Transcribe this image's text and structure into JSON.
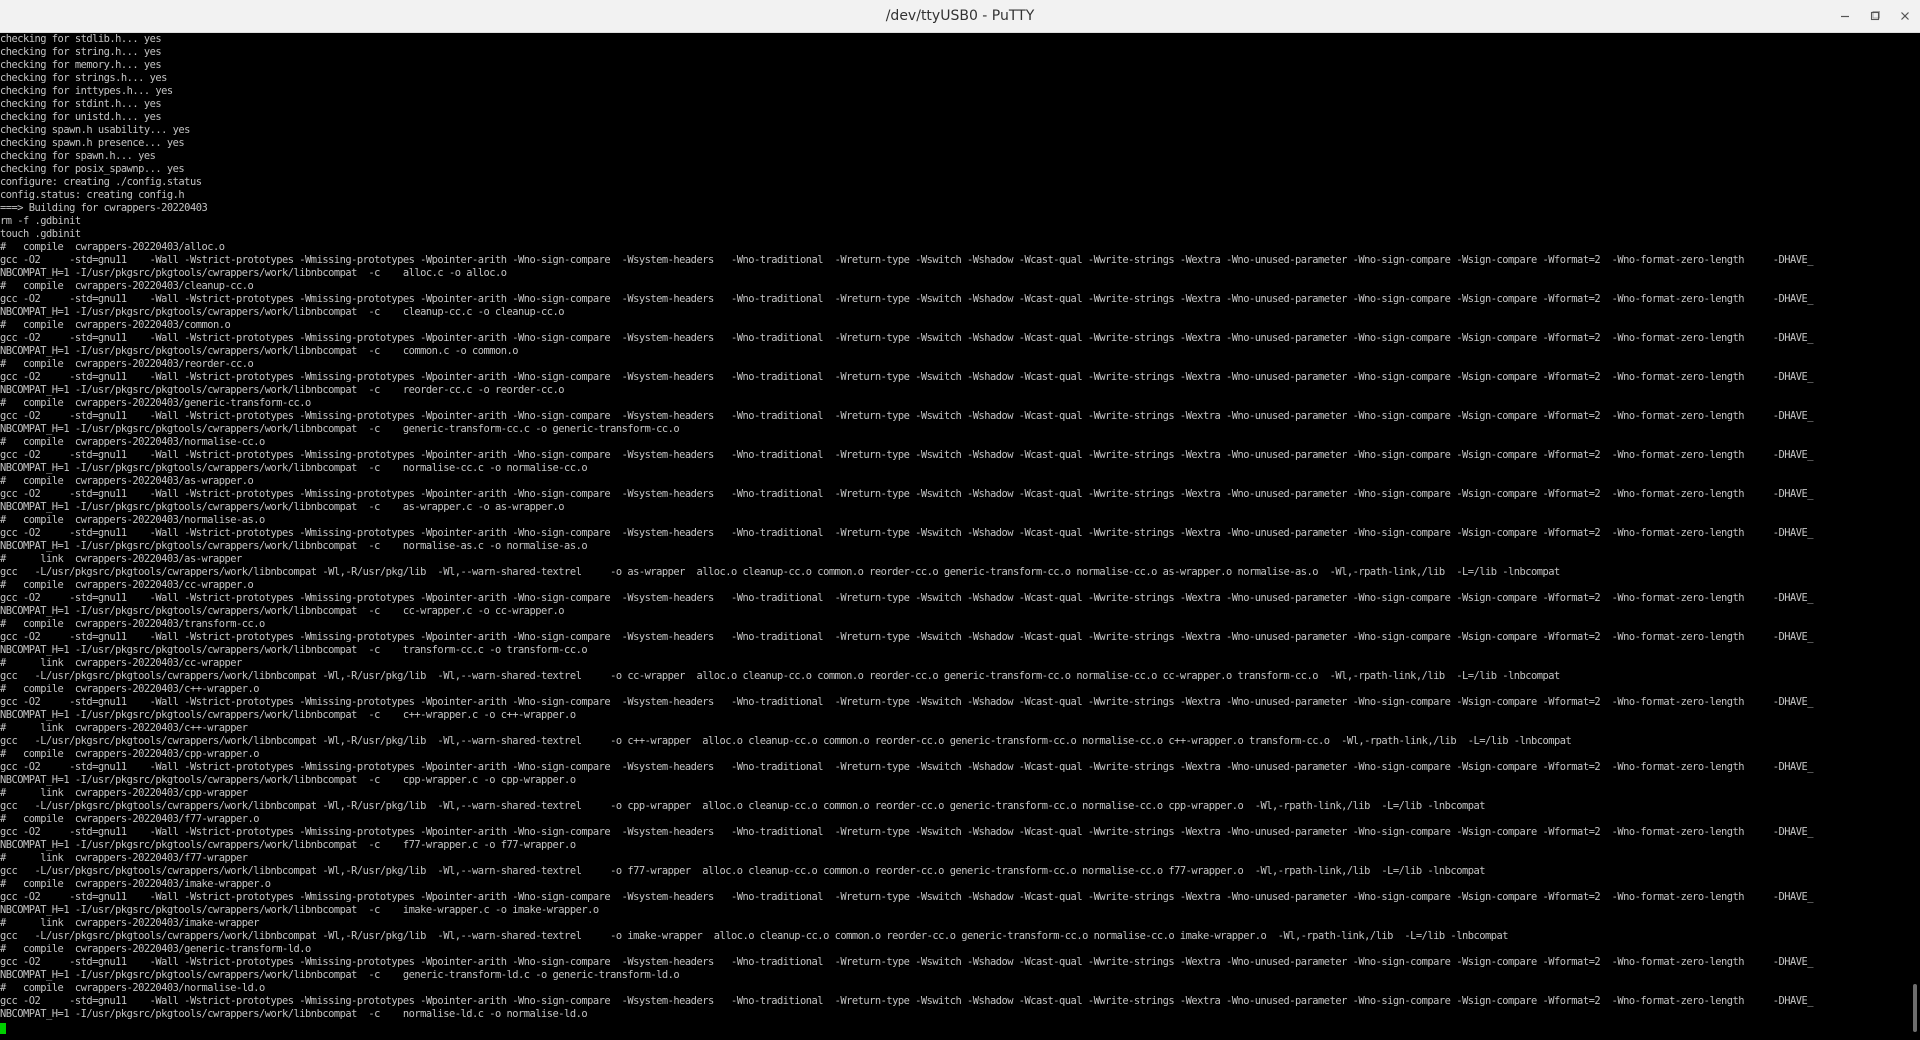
{
  "window": {
    "title": "/dev/ttyUSB0 - PuTTY",
    "controls": {
      "minimize_icon": "minimize-icon",
      "maximize_icon": "maximize-icon",
      "close_icon": "close-icon"
    }
  },
  "terminal": {
    "colors": {
      "background": "#000000",
      "foreground": "#c4c4c4",
      "cursor": "#00d000"
    },
    "lines": [
      "checking for stdlib.h... yes",
      "checking for string.h... yes",
      "checking for memory.h... yes",
      "checking for strings.h... yes",
      "checking for inttypes.h... yes",
      "checking for stdint.h... yes",
      "checking for unistd.h... yes",
      "checking spawn.h usability... yes",
      "checking spawn.h presence... yes",
      "checking for spawn.h... yes",
      "checking for posix_spawnp... yes",
      "configure: creating ./config.status",
      "config.status: creating config.h",
      "===> Building for cwrappers-20220403",
      "rm -f .gdbinit",
      "touch .gdbinit",
      "#   compile  cwrappers-20220403/alloc.o",
      "gcc -O2     -std=gnu11    -Wall -Wstrict-prototypes -Wmissing-prototypes -Wpointer-arith -Wno-sign-compare  -Wsystem-headers   -Wno-traditional  -Wreturn-type -Wswitch -Wshadow -Wcast-qual -Wwrite-strings -Wextra -Wno-unused-parameter -Wno-sign-compare -Wsign-compare -Wformat=2  -Wno-format-zero-length     -DHAVE_",
      "NBCOMPAT_H=1 -I/usr/pkgsrc/pkgtools/cwrappers/work/libnbcompat  -c    alloc.c -o alloc.o",
      "#   compile  cwrappers-20220403/cleanup-cc.o",
      "gcc -O2     -std=gnu11    -Wall -Wstrict-prototypes -Wmissing-prototypes -Wpointer-arith -Wno-sign-compare  -Wsystem-headers   -Wno-traditional  -Wreturn-type -Wswitch -Wshadow -Wcast-qual -Wwrite-strings -Wextra -Wno-unused-parameter -Wno-sign-compare -Wsign-compare -Wformat=2  -Wno-format-zero-length     -DHAVE_",
      "NBCOMPAT_H=1 -I/usr/pkgsrc/pkgtools/cwrappers/work/libnbcompat  -c    cleanup-cc.c -o cleanup-cc.o",
      "#   compile  cwrappers-20220403/common.o",
      "gcc -O2     -std=gnu11    -Wall -Wstrict-prototypes -Wmissing-prototypes -Wpointer-arith -Wno-sign-compare  -Wsystem-headers   -Wno-traditional  -Wreturn-type -Wswitch -Wshadow -Wcast-qual -Wwrite-strings -Wextra -Wno-unused-parameter -Wno-sign-compare -Wsign-compare -Wformat=2  -Wno-format-zero-length     -DHAVE_",
      "NBCOMPAT_H=1 -I/usr/pkgsrc/pkgtools/cwrappers/work/libnbcompat  -c    common.c -o common.o",
      "#   compile  cwrappers-20220403/reorder-cc.o",
      "gcc -O2     -std=gnu11    -Wall -Wstrict-prototypes -Wmissing-prototypes -Wpointer-arith -Wno-sign-compare  -Wsystem-headers   -Wno-traditional  -Wreturn-type -Wswitch -Wshadow -Wcast-qual -Wwrite-strings -Wextra -Wno-unused-parameter -Wno-sign-compare -Wsign-compare -Wformat=2  -Wno-format-zero-length     -DHAVE_",
      "NBCOMPAT_H=1 -I/usr/pkgsrc/pkgtools/cwrappers/work/libnbcompat  -c    reorder-cc.c -o reorder-cc.o",
      "#   compile  cwrappers-20220403/generic-transform-cc.o",
      "gcc -O2     -std=gnu11    -Wall -Wstrict-prototypes -Wmissing-prototypes -Wpointer-arith -Wno-sign-compare  -Wsystem-headers   -Wno-traditional  -Wreturn-type -Wswitch -Wshadow -Wcast-qual -Wwrite-strings -Wextra -Wno-unused-parameter -Wno-sign-compare -Wsign-compare -Wformat=2  -Wno-format-zero-length     -DHAVE_",
      "NBCOMPAT_H=1 -I/usr/pkgsrc/pkgtools/cwrappers/work/libnbcompat  -c    generic-transform-cc.c -o generic-transform-cc.o",
      "#   compile  cwrappers-20220403/normalise-cc.o",
      "gcc -O2     -std=gnu11    -Wall -Wstrict-prototypes -Wmissing-prototypes -Wpointer-arith -Wno-sign-compare  -Wsystem-headers   -Wno-traditional  -Wreturn-type -Wswitch -Wshadow -Wcast-qual -Wwrite-strings -Wextra -Wno-unused-parameter -Wno-sign-compare -Wsign-compare -Wformat=2  -Wno-format-zero-length     -DHAVE_",
      "NBCOMPAT_H=1 -I/usr/pkgsrc/pkgtools/cwrappers/work/libnbcompat  -c    normalise-cc.c -o normalise-cc.o",
      "#   compile  cwrappers-20220403/as-wrapper.o",
      "gcc -O2     -std=gnu11    -Wall -Wstrict-prototypes -Wmissing-prototypes -Wpointer-arith -Wno-sign-compare  -Wsystem-headers   -Wno-traditional  -Wreturn-type -Wswitch -Wshadow -Wcast-qual -Wwrite-strings -Wextra -Wno-unused-parameter -Wno-sign-compare -Wsign-compare -Wformat=2  -Wno-format-zero-length     -DHAVE_",
      "NBCOMPAT_H=1 -I/usr/pkgsrc/pkgtools/cwrappers/work/libnbcompat  -c    as-wrapper.c -o as-wrapper.o",
      "#   compile  cwrappers-20220403/normalise-as.o",
      "gcc -O2     -std=gnu11    -Wall -Wstrict-prototypes -Wmissing-prototypes -Wpointer-arith -Wno-sign-compare  -Wsystem-headers   -Wno-traditional  -Wreturn-type -Wswitch -Wshadow -Wcast-qual -Wwrite-strings -Wextra -Wno-unused-parameter -Wno-sign-compare -Wsign-compare -Wformat=2  -Wno-format-zero-length     -DHAVE_",
      "NBCOMPAT_H=1 -I/usr/pkgsrc/pkgtools/cwrappers/work/libnbcompat  -c    normalise-as.c -o normalise-as.o",
      "#      link  cwrappers-20220403/as-wrapper",
      "gcc   -L/usr/pkgsrc/pkgtools/cwrappers/work/libnbcompat -Wl,-R/usr/pkg/lib  -Wl,--warn-shared-textrel     -o as-wrapper  alloc.o cleanup-cc.o common.o reorder-cc.o generic-transform-cc.o normalise-cc.o as-wrapper.o normalise-as.o  -Wl,-rpath-link,/lib  -L=/lib -lnbcompat",
      "#   compile  cwrappers-20220403/cc-wrapper.o",
      "gcc -O2     -std=gnu11    -Wall -Wstrict-prototypes -Wmissing-prototypes -Wpointer-arith -Wno-sign-compare  -Wsystem-headers   -Wno-traditional  -Wreturn-type -Wswitch -Wshadow -Wcast-qual -Wwrite-strings -Wextra -Wno-unused-parameter -Wno-sign-compare -Wsign-compare -Wformat=2  -Wno-format-zero-length     -DHAVE_",
      "NBCOMPAT_H=1 -I/usr/pkgsrc/pkgtools/cwrappers/work/libnbcompat  -c    cc-wrapper.c -o cc-wrapper.o",
      "#   compile  cwrappers-20220403/transform-cc.o",
      "gcc -O2     -std=gnu11    -Wall -Wstrict-prototypes -Wmissing-prototypes -Wpointer-arith -Wno-sign-compare  -Wsystem-headers   -Wno-traditional  -Wreturn-type -Wswitch -Wshadow -Wcast-qual -Wwrite-strings -Wextra -Wno-unused-parameter -Wno-sign-compare -Wsign-compare -Wformat=2  -Wno-format-zero-length     -DHAVE_",
      "NBCOMPAT_H=1 -I/usr/pkgsrc/pkgtools/cwrappers/work/libnbcompat  -c    transform-cc.c -o transform-cc.o",
      "#      link  cwrappers-20220403/cc-wrapper",
      "gcc   -L/usr/pkgsrc/pkgtools/cwrappers/work/libnbcompat -Wl,-R/usr/pkg/lib  -Wl,--warn-shared-textrel     -o cc-wrapper  alloc.o cleanup-cc.o common.o reorder-cc.o generic-transform-cc.o normalise-cc.o cc-wrapper.o transform-cc.o  -Wl,-rpath-link,/lib  -L=/lib -lnbcompat",
      "#   compile  cwrappers-20220403/c++-wrapper.o",
      "gcc -O2     -std=gnu11    -Wall -Wstrict-prototypes -Wmissing-prototypes -Wpointer-arith -Wno-sign-compare  -Wsystem-headers   -Wno-traditional  -Wreturn-type -Wswitch -Wshadow -Wcast-qual -Wwrite-strings -Wextra -Wno-unused-parameter -Wno-sign-compare -Wsign-compare -Wformat=2  -Wno-format-zero-length     -DHAVE_",
      "NBCOMPAT_H=1 -I/usr/pkgsrc/pkgtools/cwrappers/work/libnbcompat  -c    c++-wrapper.c -o c++-wrapper.o",
      "#      link  cwrappers-20220403/c++-wrapper",
      "gcc   -L/usr/pkgsrc/pkgtools/cwrappers/work/libnbcompat -Wl,-R/usr/pkg/lib  -Wl,--warn-shared-textrel     -o c++-wrapper  alloc.o cleanup-cc.o common.o reorder-cc.o generic-transform-cc.o normalise-cc.o c++-wrapper.o transform-cc.o  -Wl,-rpath-link,/lib  -L=/lib -lnbcompat",
      "#   compile  cwrappers-20220403/cpp-wrapper.o",
      "gcc -O2     -std=gnu11    -Wall -Wstrict-prototypes -Wmissing-prototypes -Wpointer-arith -Wno-sign-compare  -Wsystem-headers   -Wno-traditional  -Wreturn-type -Wswitch -Wshadow -Wcast-qual -Wwrite-strings -Wextra -Wno-unused-parameter -Wno-sign-compare -Wsign-compare -Wformat=2  -Wno-format-zero-length     -DHAVE_",
      "NBCOMPAT_H=1 -I/usr/pkgsrc/pkgtools/cwrappers/work/libnbcompat  -c    cpp-wrapper.c -o cpp-wrapper.o",
      "#      link  cwrappers-20220403/cpp-wrapper",
      "gcc   -L/usr/pkgsrc/pkgtools/cwrappers/work/libnbcompat -Wl,-R/usr/pkg/lib  -Wl,--warn-shared-textrel     -o cpp-wrapper  alloc.o cleanup-cc.o common.o reorder-cc.o generic-transform-cc.o normalise-cc.o cpp-wrapper.o  -Wl,-rpath-link,/lib  -L=/lib -lnbcompat",
      "#   compile  cwrappers-20220403/f77-wrapper.o",
      "gcc -O2     -std=gnu11    -Wall -Wstrict-prototypes -Wmissing-prototypes -Wpointer-arith -Wno-sign-compare  -Wsystem-headers   -Wno-traditional  -Wreturn-type -Wswitch -Wshadow -Wcast-qual -Wwrite-strings -Wextra -Wno-unused-parameter -Wno-sign-compare -Wsign-compare -Wformat=2  -Wno-format-zero-length     -DHAVE_",
      "NBCOMPAT_H=1 -I/usr/pkgsrc/pkgtools/cwrappers/work/libnbcompat  -c    f77-wrapper.c -o f77-wrapper.o",
      "#      link  cwrappers-20220403/f77-wrapper",
      "gcc   -L/usr/pkgsrc/pkgtools/cwrappers/work/libnbcompat -Wl,-R/usr/pkg/lib  -Wl,--warn-shared-textrel     -o f77-wrapper  alloc.o cleanup-cc.o common.o reorder-cc.o generic-transform-cc.o normalise-cc.o f77-wrapper.o  -Wl,-rpath-link,/lib  -L=/lib -lnbcompat",
      "#   compile  cwrappers-20220403/imake-wrapper.o",
      "gcc -O2     -std=gnu11    -Wall -Wstrict-prototypes -Wmissing-prototypes -Wpointer-arith -Wno-sign-compare  -Wsystem-headers   -Wno-traditional  -Wreturn-type -Wswitch -Wshadow -Wcast-qual -Wwrite-strings -Wextra -Wno-unused-parameter -Wno-sign-compare -Wsign-compare -Wformat=2  -Wno-format-zero-length     -DHAVE_",
      "NBCOMPAT_H=1 -I/usr/pkgsrc/pkgtools/cwrappers/work/libnbcompat  -c    imake-wrapper.c -o imake-wrapper.o",
      "#      link  cwrappers-20220403/imake-wrapper",
      "gcc   -L/usr/pkgsrc/pkgtools/cwrappers/work/libnbcompat -Wl,-R/usr/pkg/lib  -Wl,--warn-shared-textrel     -o imake-wrapper  alloc.o cleanup-cc.o common.o reorder-cc.o generic-transform-cc.o normalise-cc.o imake-wrapper.o  -Wl,-rpath-link,/lib  -L=/lib -lnbcompat",
      "#   compile  cwrappers-20220403/generic-transform-ld.o",
      "gcc -O2     -std=gnu11    -Wall -Wstrict-prototypes -Wmissing-prototypes -Wpointer-arith -Wno-sign-compare  -Wsystem-headers   -Wno-traditional  -Wreturn-type -Wswitch -Wshadow -Wcast-qual -Wwrite-strings -Wextra -Wno-unused-parameter -Wno-sign-compare -Wsign-compare -Wformat=2  -Wno-format-zero-length     -DHAVE_",
      "NBCOMPAT_H=1 -I/usr/pkgsrc/pkgtools/cwrappers/work/libnbcompat  -c    generic-transform-ld.c -o generic-transform-ld.o",
      "#   compile  cwrappers-20220403/normalise-ld.o",
      "gcc -O2     -std=gnu11    -Wall -Wstrict-prototypes -Wmissing-prototypes -Wpointer-arith -Wno-sign-compare  -Wsystem-headers   -Wno-traditional  -Wreturn-type -Wswitch -Wshadow -Wcast-qual -Wwrite-strings -Wextra -Wno-unused-parameter -Wno-sign-compare -Wsign-compare -Wformat=2  -Wno-format-zero-length     -DHAVE_",
      "NBCOMPAT_H=1 -I/usr/pkgsrc/pkgtools/cwrappers/work/libnbcompat  -c    normalise-ld.c -o normalise-ld.o"
    ]
  }
}
